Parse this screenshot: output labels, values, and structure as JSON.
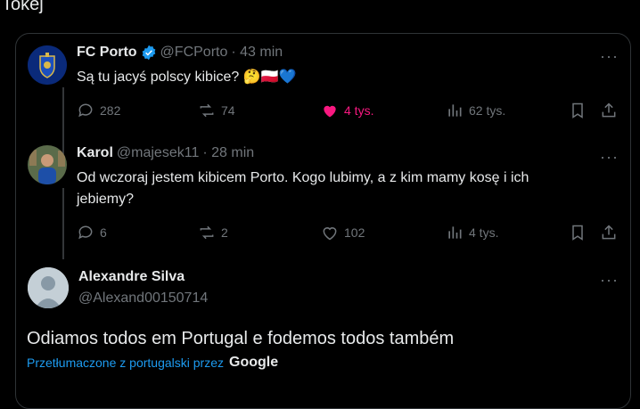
{
  "top_text": "Tokej",
  "quoted": {
    "name": "FC Porto",
    "handle": "@FCPorto",
    "time": "· 43 min",
    "text": "Są tu jacyś polscy kibice? 🤔🇵🇱💙",
    "stats": {
      "replies": "282",
      "reposts": "74",
      "likes": "4 tys.",
      "views": "62 tys."
    }
  },
  "reply": {
    "name": "Karol",
    "handle": "@majesek11",
    "time": "· 28 min",
    "text": "Od wczoraj jestem kibicem Porto. Kogo lubimy, a z kim mamy kosę i ich jebiemy?",
    "stats": {
      "replies": "6",
      "reposts": "2",
      "likes": "102",
      "views": "4 tys."
    }
  },
  "third": {
    "name": "Alexandre Silva",
    "handle": "@Alexand00150714",
    "text": "Odiamos todos em Portugal e fodemos todos também",
    "translate_label": "Przetłumaczone z portugalski przez",
    "translate_provider": "Google"
  },
  "colors": {
    "like": "#f91880",
    "verified": "#1d9bf0",
    "muted": "#71767b"
  }
}
